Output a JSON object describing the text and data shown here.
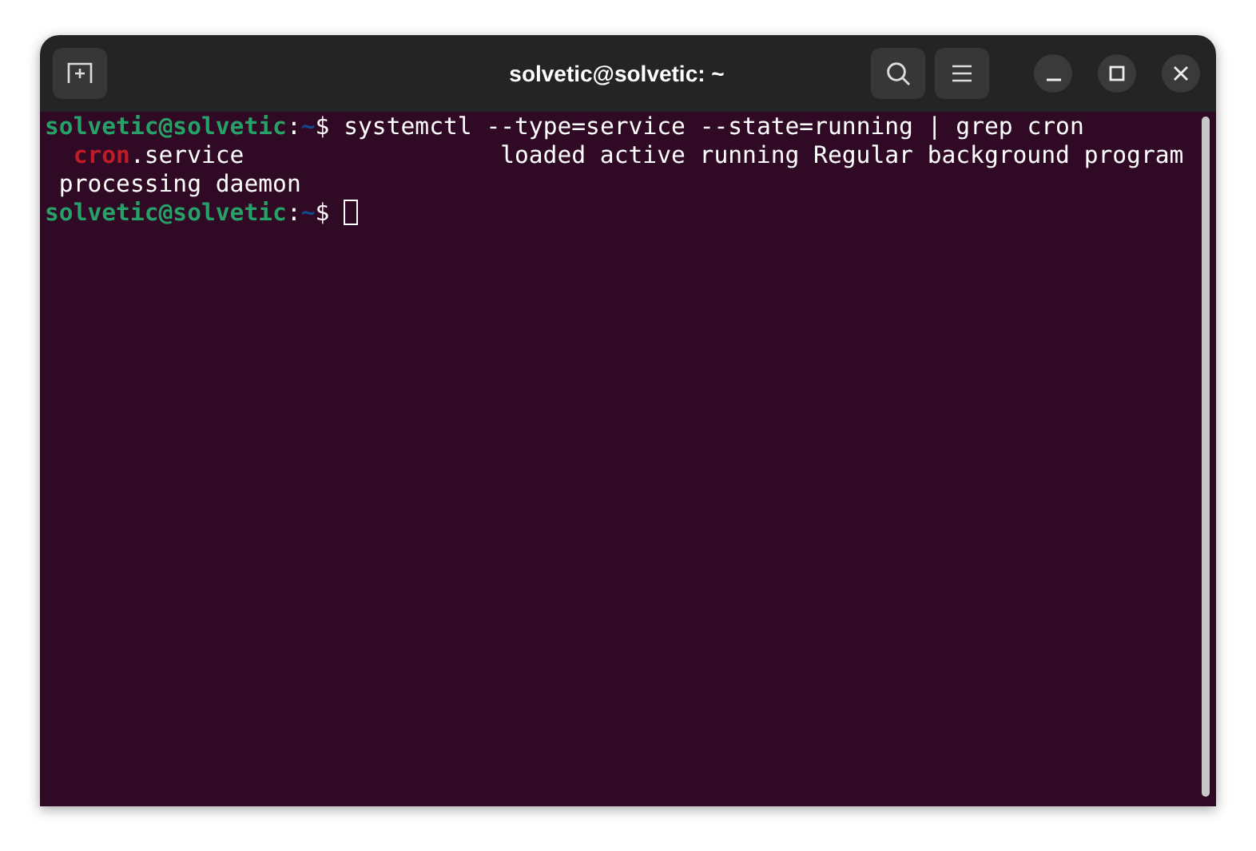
{
  "window": {
    "title": "solvetic@solvetic: ~"
  },
  "terminal": {
    "lines": [
      [
        {
          "kind": "host",
          "text": "solvetic@solvetic"
        },
        {
          "kind": "plain",
          "text": ":"
        },
        {
          "kind": "path",
          "text": "~"
        },
        {
          "kind": "plain",
          "text": "$ systemctl --type=service --state=running | grep cron"
        }
      ],
      [
        {
          "kind": "match",
          "text": "  cron"
        },
        {
          "kind": "plain",
          "text": ".service                  loaded active running Regular background program"
        }
      ],
      [
        {
          "kind": "plain",
          "text": " processing daemon"
        }
      ],
      [
        {
          "kind": "host",
          "text": "solvetic@solvetic"
        },
        {
          "kind": "plain",
          "text": ":"
        },
        {
          "kind": "path",
          "text": "~"
        },
        {
          "kind": "plain",
          "text": "$ "
        },
        {
          "kind": "cursor"
        }
      ]
    ]
  }
}
